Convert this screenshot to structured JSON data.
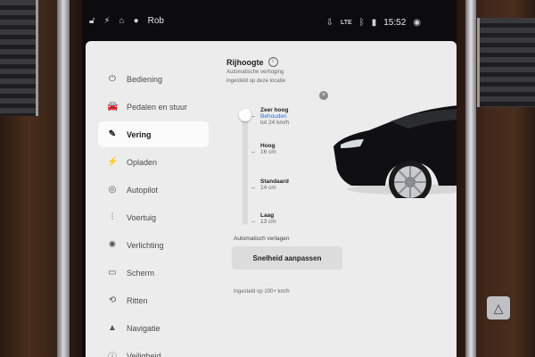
{
  "status": {
    "user": "Rob",
    "network": "LTE",
    "time": "15:52"
  },
  "sidebar": {
    "items": [
      {
        "label": "Bediening",
        "icon": "toggle-icon",
        "glyph": "⏻"
      },
      {
        "label": "Pedalen en stuur",
        "icon": "car-icon",
        "glyph": "🚘"
      },
      {
        "label": "Vering",
        "icon": "wrench-icon",
        "glyph": "✎"
      },
      {
        "label": "Opladen",
        "icon": "bolt-icon",
        "glyph": "⚡"
      },
      {
        "label": "Autopilot",
        "icon": "steering-wheel-icon",
        "glyph": "◎"
      },
      {
        "label": "Voertuig",
        "icon": "sliders-icon",
        "glyph": "⫶"
      },
      {
        "label": "Verlichting",
        "icon": "light-icon",
        "glyph": "✺"
      },
      {
        "label": "Scherm",
        "icon": "screen-icon",
        "glyph": "▭"
      },
      {
        "label": "Ritten",
        "icon": "trips-icon",
        "glyph": "⟲"
      },
      {
        "label": "Navigatie",
        "icon": "navigation-icon",
        "glyph": "▲"
      },
      {
        "label": "Veiligheid",
        "icon": "safety-icon",
        "glyph": "ⓘ"
      }
    ],
    "active_index": 2
  },
  "suspension": {
    "title": "Rijhoogte",
    "sub1": "Automatische verhoging",
    "sub2": "ingesteld op deze locatie",
    "levels": [
      {
        "name": "Zeer hoog",
        "extra": "Behouden",
        "val": "tot 24 km/h"
      },
      {
        "name": "Hoog",
        "val": "16 cm"
      },
      {
        "name": "Standaard",
        "val": "14 cm"
      },
      {
        "name": "Laag",
        "val": "13 cm"
      }
    ],
    "level_fraction": 0,
    "auto_lower_label": "Automatisch verlagen",
    "button_label": "Snelheid aanpassen",
    "note": "Ingesteld op 100+ km/h"
  },
  "colors": {
    "panel_bg": "#ececec",
    "accent_blue": "#2a6fdb",
    "active_item_bg": "#fbfbfb"
  }
}
